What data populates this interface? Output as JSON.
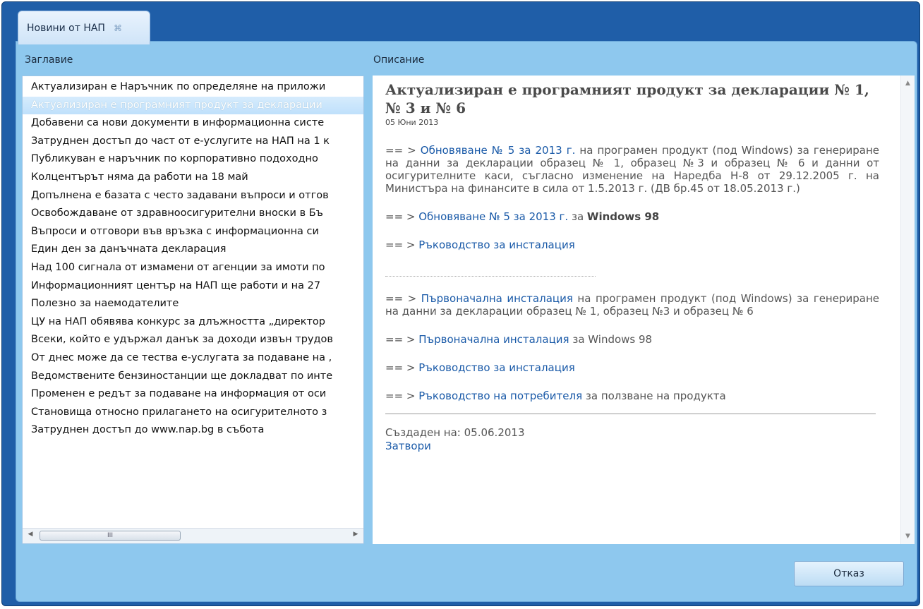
{
  "tab": {
    "title": "Новини от НАП",
    "close_icon": "⌘"
  },
  "columns": {
    "title_header": "Заглавие",
    "description_header": "Описание"
  },
  "news_list": [
    "Актуализиран е Наръчник по определяне на приложи",
    "Актуализиран е програмният продукт за декларации",
    "Добавени са нови документи в информационна систе",
    "Затруднен достъп до част от е-услугите на НАП на 1 к",
    "Публикуван е наръчник по корпоративно подоходно",
    "Колцентърът няма да работи на 18 май",
    "Допълнена е базата с често задавани въпроси и отгов",
    "Освобождаване от здравноосигурителни вноски в Бъ",
    "Въпроси и отговори във връзка с информационна си",
    "Един ден за данъчната декларация",
    "Над 100 сигнала от измамени от агенции за имоти по",
    "Информационният център на НАП ще работи и на 27",
    "Полезно за наемодателите",
    "ЦУ на НАП обявява конкурс за длъжността „директор",
    "Всеки, който е удържал данък за доходи извън трудов",
    "От днес може да се тества е-услугата за подаване на ,",
    "Ведомствените бензиностанции ще докладват по инте",
    "Променен е редът за подаване на информация от оси",
    "Становища относно прилагането на осигурителното з",
    "Затруднен достъп до www.nap.bg в събота"
  ],
  "selected_index": 1,
  "hscroll": {
    "left_arrow": "◀",
    "right_arrow": "▶",
    "thumb_grip": "III"
  },
  "description": {
    "title": "Актуализиран е програмният продукт за декларации № 1, № 3 и № 6",
    "date": "05 Юни 2013",
    "p1_prefix": "== > ",
    "p1_link": "Обновяване № 5 за 2013 г.",
    "p1_text": " на програмен продукт (под Windows) за генериране на данни за декларации образец № 1, образец №3 и образец № 6 и данни от осигурителните каси, съгласно изменение на Наредба Н-8 от 29.12.2005 г. на Министъра на финансите в сила от 1.5.2013 г. (ДВ бр.45 от 18.05.2013 г.)",
    "p2_prefix": "== > ",
    "p2_link": "Обновяване № 5 за 2013 г.",
    "p2_mid": "  за ",
    "p2_bold": "Windows 98",
    "p3_prefix": "== > ",
    "p3_link": "Ръководство за инсталация",
    "p4_prefix": "== > ",
    "p4_link": "Първоначална инсталация",
    "p4_text": " на програмен продукт (под Windows) за генериране на данни за декларации образец № 1, образец №3 и образец № 6",
    "p5_prefix": "== >  ",
    "p5_link": "Първоначална инсталация",
    "p5_text": " за Windows 98",
    "p6_prefix": "== >  ",
    "p6_link": "Ръководство за инсталация",
    "p7_prefix": "== >  ",
    "p7_link": "Ръководство на потребителя",
    "p7_text": " за ползване на продукта",
    "created": "Създаден на: 05.06.2013",
    "close_link": "Затвори"
  },
  "vscroll": {
    "up_arrow": "▲",
    "down_arrow": "▼"
  },
  "buttons": {
    "cancel": "Отказ"
  }
}
